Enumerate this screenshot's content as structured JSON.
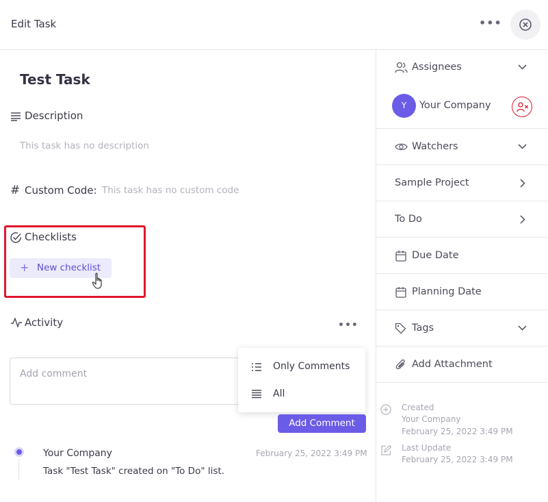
{
  "header": {
    "title": "Edit Task",
    "more_label": "•••"
  },
  "task": {
    "title": "Test Task",
    "description_label": "Description",
    "description_empty": "This task has no description",
    "custom_code_label": "Custom Code:",
    "custom_code_empty": "This task has no custom code",
    "checklists_label": "Checklists",
    "new_checklist_label": "New checklist",
    "activity_label": "Activity",
    "activity_more_label": "•••"
  },
  "comment": {
    "placeholder": "Add comment",
    "button_label": "Add Comment"
  },
  "filter_menu": {
    "items": [
      {
        "label": "Only Comments"
      },
      {
        "label": "All"
      }
    ]
  },
  "activity": [
    {
      "user": "Your Company",
      "date": "February 25, 2022 3:49 PM",
      "text": "Task \"Test Task\" created on \"To Do\" list."
    }
  ],
  "sidebar": {
    "assignees_label": "Assignees",
    "assignee": {
      "initial": "Y",
      "name": "Your Company"
    },
    "watchers_label": "Watchers",
    "project_label": "Sample Project",
    "list_label": "To Do",
    "due_date_label": "Due Date",
    "planning_date_label": "Planning Date",
    "tags_label": "Tags",
    "attachment_label": "Add Attachment",
    "created_label": "Created",
    "created_by": "Your Company",
    "created_date": "February 25, 2022 3:49 PM",
    "updated_label": "Last Update",
    "updated_date": "February 25, 2022 3:49 PM"
  },
  "colors": {
    "accent": "#6b5ce7",
    "highlight": "#e0162b"
  }
}
